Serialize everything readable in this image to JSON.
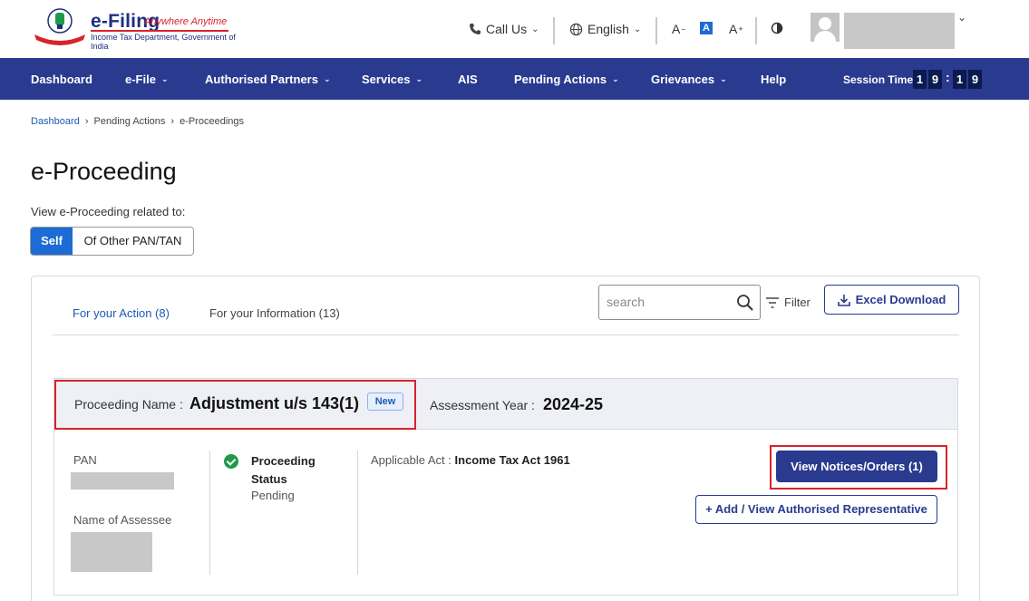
{
  "header": {
    "brand_title": "e-Filing",
    "brand_tagline": "Anywhere Anytime",
    "brand_subtitle": "Income Tax Department, Government of India",
    "call_us": "Call Us",
    "language": "English",
    "font_decrease": "A",
    "font_normal": "A",
    "font_increase": "A"
  },
  "nav": {
    "items": [
      {
        "label": "Dashboard",
        "has_menu": false
      },
      {
        "label": "e-File",
        "has_menu": true
      },
      {
        "label": "Authorised Partners",
        "has_menu": true
      },
      {
        "label": "Services",
        "has_menu": true
      },
      {
        "label": "AIS",
        "has_menu": false
      },
      {
        "label": "Pending Actions",
        "has_menu": true
      },
      {
        "label": "Grievances",
        "has_menu": true
      },
      {
        "label": "Help",
        "has_menu": false
      }
    ],
    "session_label": "Session Time",
    "session_digits": [
      "1",
      "9",
      "1",
      "9"
    ],
    "session_separator": ":"
  },
  "breadcrumb": {
    "items": [
      "Dashboard",
      "Pending Actions",
      "e-Proceedings"
    ],
    "separator": "›"
  },
  "page": {
    "title": "e-Proceeding",
    "related_label": "View e-Proceeding related to:",
    "toggle_self": "Self",
    "toggle_other": "Of Other PAN/TAN"
  },
  "tabs": {
    "action": "For your Action (8)",
    "information": "For your Information (13)"
  },
  "toolbar": {
    "search_placeholder": "search",
    "filter_label": "Filter",
    "excel_label": "Excel Download"
  },
  "proceeding": {
    "name_label": "Proceeding Name :",
    "name_value": "Adjustment u/s 143(1)",
    "new_badge": "New",
    "ay_label": "Assessment Year :",
    "ay_value": "2024-25",
    "pan_label": "PAN",
    "assessee_label": "Name of Assessee",
    "status_label": "Proceeding Status",
    "status_value": "Pending",
    "act_label": "Applicable Act :",
    "act_value": "Income Tax Act 1961",
    "view_notices_button": "View Notices/Orders (1)",
    "add_rep_button": "+ Add / View Authorised Representative"
  },
  "colors": {
    "brand_navy": "#2a3a8f",
    "link_blue": "#1d5bb5",
    "highlight_red": "#d8232a",
    "status_green": "#1e9a4a"
  }
}
